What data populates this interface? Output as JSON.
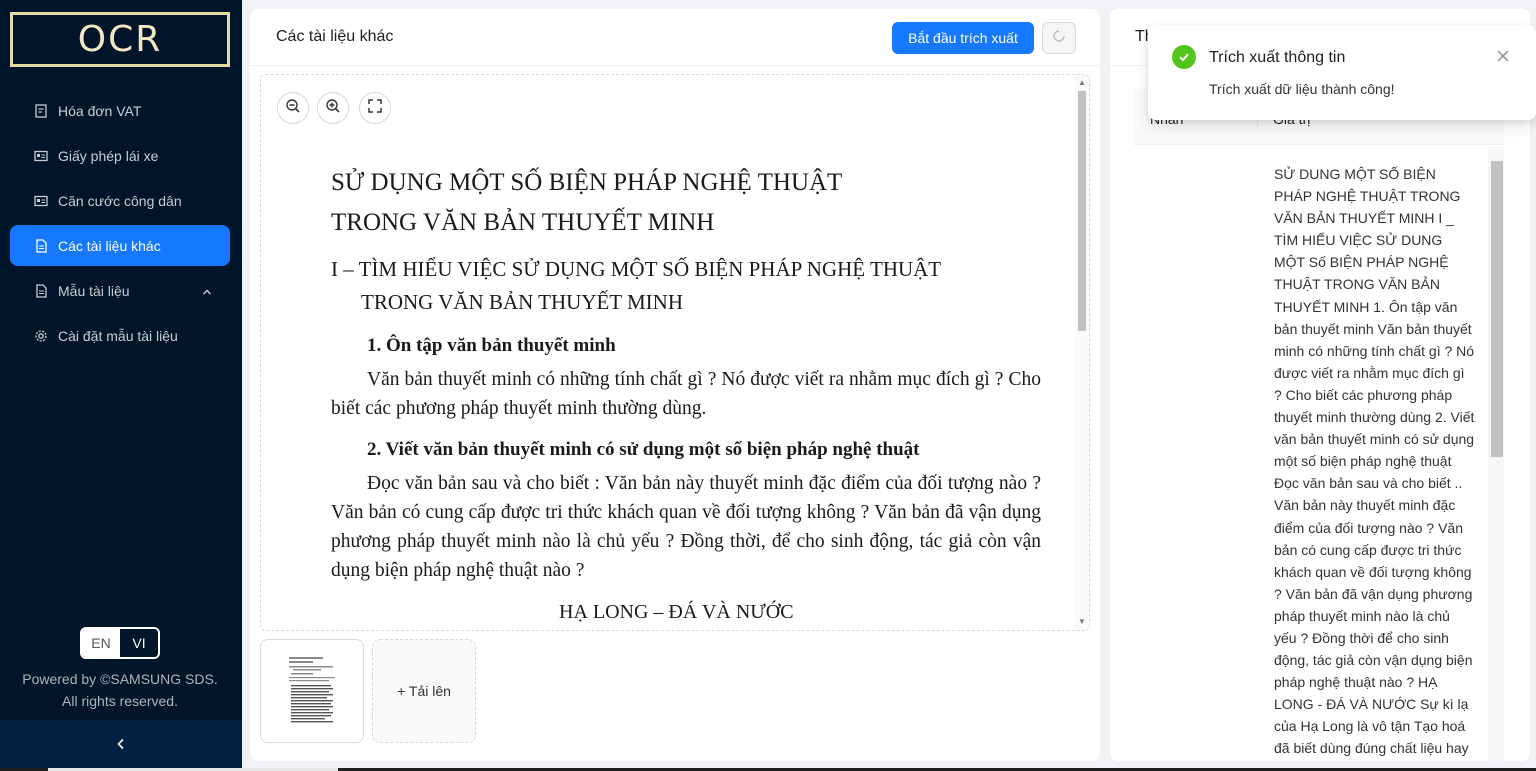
{
  "app": {
    "logo_text": "OCR",
    "brand_color": "#1677ff",
    "sidebar_bg": "#001529"
  },
  "sidebar": {
    "items": [
      {
        "label": "Hóa đơn VAT",
        "icon": "invoice-icon",
        "active": false
      },
      {
        "label": "Giấy phép lái xe",
        "icon": "id-card-icon",
        "active": false
      },
      {
        "label": "Căn cước công dân",
        "icon": "id-card-icon",
        "active": false
      },
      {
        "label": "Các tài liệu khác",
        "icon": "file-icon",
        "active": true
      },
      {
        "label": "Mẫu tài liệu",
        "icon": "file-icon",
        "active": false,
        "expandable": true
      },
      {
        "label": "Cài đặt mẫu tài liệu",
        "icon": "gear-icon",
        "active": false
      }
    ],
    "lang_en": "EN",
    "lang_vi": "VI",
    "selected_lang": "VI",
    "powered_line1": "Powered by ©SAMSUNG SDS.",
    "powered_line2": "All rights reserved."
  },
  "main": {
    "title": "Các tài liệu khác",
    "extract_button": "Bắt đầu trích xuất",
    "upload_label": "+ Tải lên",
    "document": {
      "title_line1": "SỬ DỤNG MỘT SỐ BIỆN PHÁP NGHỆ THUẬT",
      "title_line2": "TRONG VĂN BẢN THUYẾT MINH",
      "section_line1": "I – TÌM HIỂU VIỆC SỬ DỤNG MỘT SỐ BIỆN PHÁP NGHỆ THUẬT",
      "section_line2": "TRONG VĂN BẢN THUYẾT MINH",
      "heading1": "1. Ôn tập văn bản thuyết minh",
      "para1": "Văn bản thuyết minh có những tính chất gì ? Nó được viết ra nhằm mục đích gì ? Cho biết các phương pháp thuyết minh thường dùng.",
      "heading2": "2. Viết văn bản thuyết minh có sử dụng một số biện pháp nghệ thuật",
      "para2": "Đọc văn bản sau và cho biết : Văn bản này thuyết minh đặc điểm của đối tượng nào ? Văn bản có cung cấp được tri thức khách quan về đối tượng không ? Văn bản đã vận dụng phương pháp thuyết minh nào là chủ yếu ? Đồng thời, để cho sinh động, tác giả còn vận dụng biện pháp nghệ thuật nào ?",
      "cut_line": "HẠ LONG – ĐÁ VÀ NƯỚC"
    }
  },
  "result": {
    "title_fragment": "Th",
    "col_label": "Nhãn",
    "col_value": "Giá trị",
    "value_text": " SỬ DUNG MỘT SỐ BIỆN PHÁP NGHỆ THUẬT TRONG VĂN BẢN THUYẾT MINH I _ TÌM HIỂU VIỆC SỬ DUNG MỘT Số BIỆN PHÁP NGHỆ THUẬT TRONG VĂN BẢN THUYẾT MINH 1. Ôn tập văn bản thuyết minh Văn bản thuyết minh có những tính chất gì ? Nó được viết ra nhằm mục đích gì ? Cho biết các phương pháp thuyết minh thường dùng 2. Viết văn bản thuyết minh có sử dụng một số biện pháp nghệ thuật Đọc văn bản sau và cho biết .. Văn bản này thuyết minh đặc điểm của đối tượng nào ? Văn bản có cung cấp được tri thức khách quan về đối tượng không ? Văn bản đã vận dụng phương pháp thuyết minh nào là chủ yếu ? Đồng thời để cho sinh động, tác giả còn vận dụng biện pháp nghệ thuật nào ? HẠ LONG - ĐÁ VÀ NƯỚC Sự kì lạ của Hạ Long là vô tận Tạo hoá đã biết dùng đúng chất liệu hay nhất cho cuộc"
  },
  "notification": {
    "title": "Trích xuất thông tin",
    "message": "Trích xuất dữ liệu thành công!",
    "status_color": "#52c41a"
  }
}
